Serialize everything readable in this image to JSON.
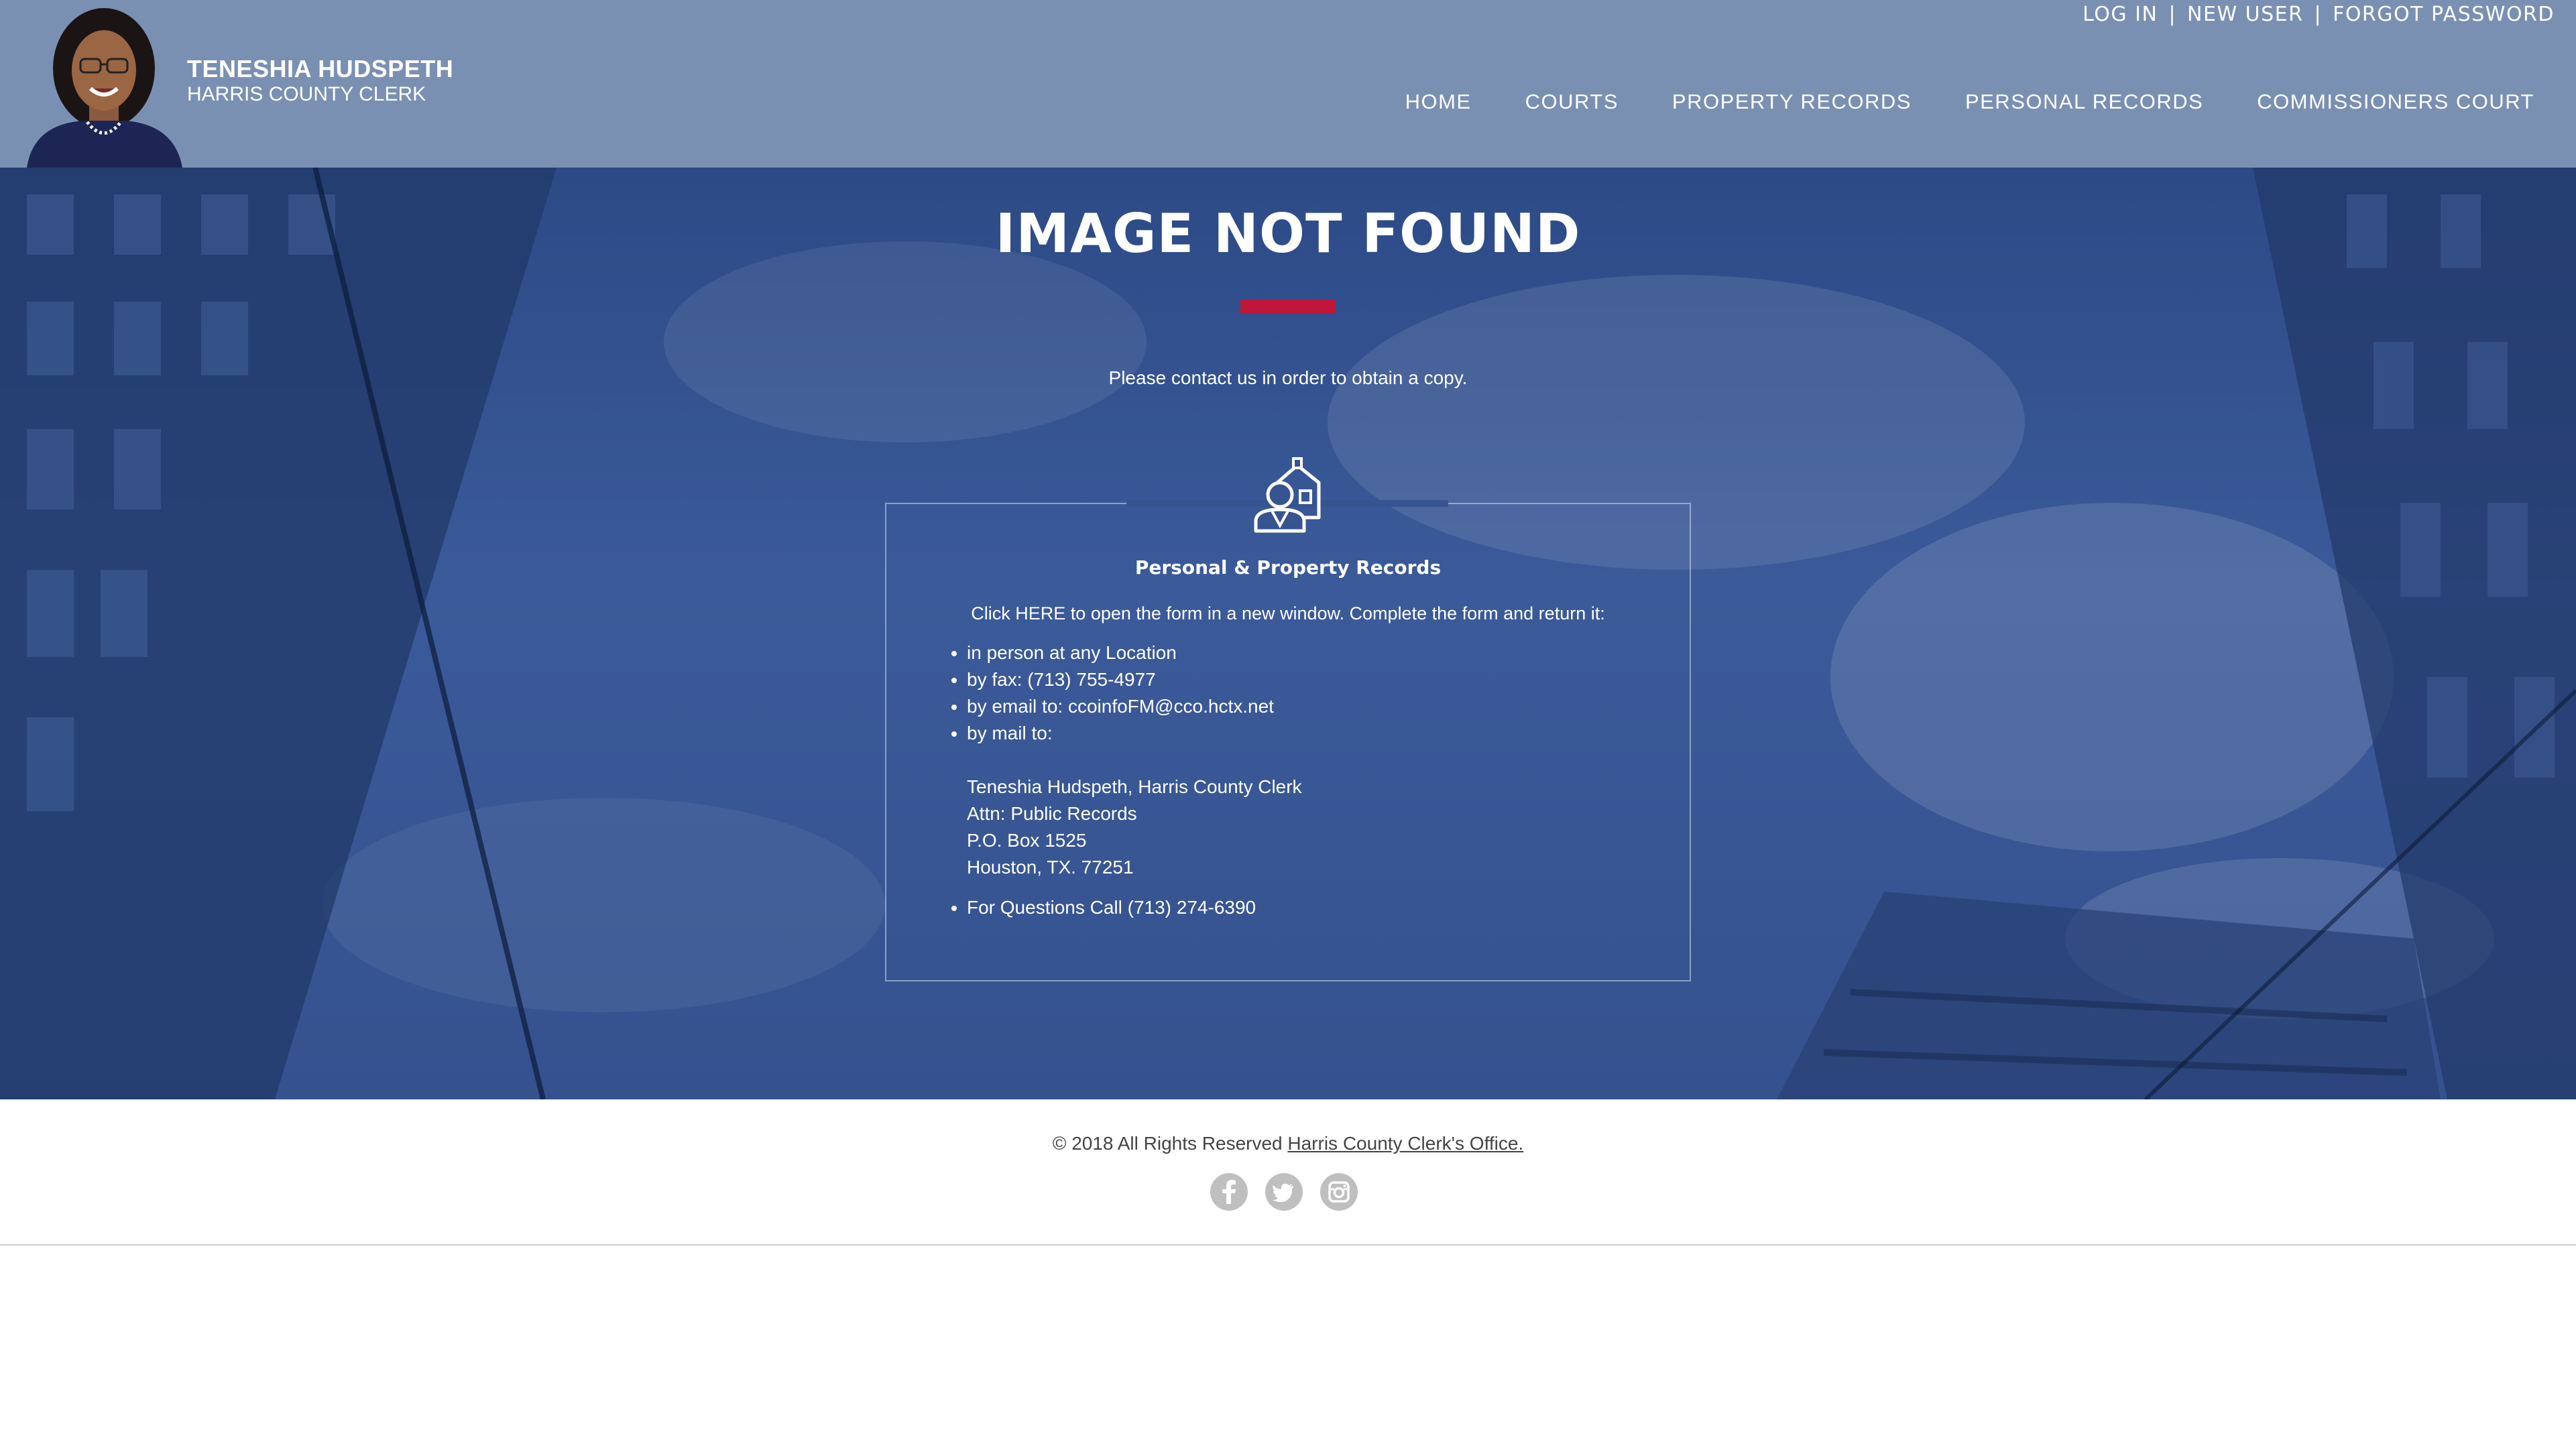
{
  "header": {
    "name": "TENESHIA HUDSPETH",
    "title": "HARRIS COUNTY CLERK",
    "top_links": [
      "LOG IN",
      "NEW USER",
      "FORGOT PASSWORD"
    ],
    "top_separator": "|",
    "nav": [
      "HOME",
      "COURTS",
      "PROPERTY RECORDS",
      "PERSONAL RECORDS",
      "COMMISSIONERS COURT"
    ]
  },
  "main": {
    "heading": "IMAGE NOT FOUND",
    "intro": "Please contact us in order to obtain a copy.",
    "box": {
      "icon": "house-person-icon",
      "title": "Personal & Property Records",
      "instructions": "Click HERE to open the form in a new window. Complete the form and return it:",
      "methods": [
        "in person at any Location",
        "by fax: (713) 755-4977",
        "by email to: ccoinfoFM@cco.hctx.net",
        "by mail to:"
      ],
      "address": [
        "Teneshia Hudspeth, Harris County Clerk",
        "Attn: Public Records",
        "P.O. Box 1525",
        "Houston, TX. 77251"
      ],
      "questions": "For Questions Call (713) 274-6390"
    }
  },
  "footer": {
    "copyright": "© 2018 All Rights Reserved",
    "link": "Harris County Clerk's Office.",
    "socials": [
      "facebook-icon",
      "twitter-icon",
      "instagram-icon"
    ]
  },
  "colors": {
    "header_bg": "#7a90b3",
    "hero_bg": "#2f4d8a",
    "accent_red": "#c0163a",
    "footer_text": "#444444"
  }
}
